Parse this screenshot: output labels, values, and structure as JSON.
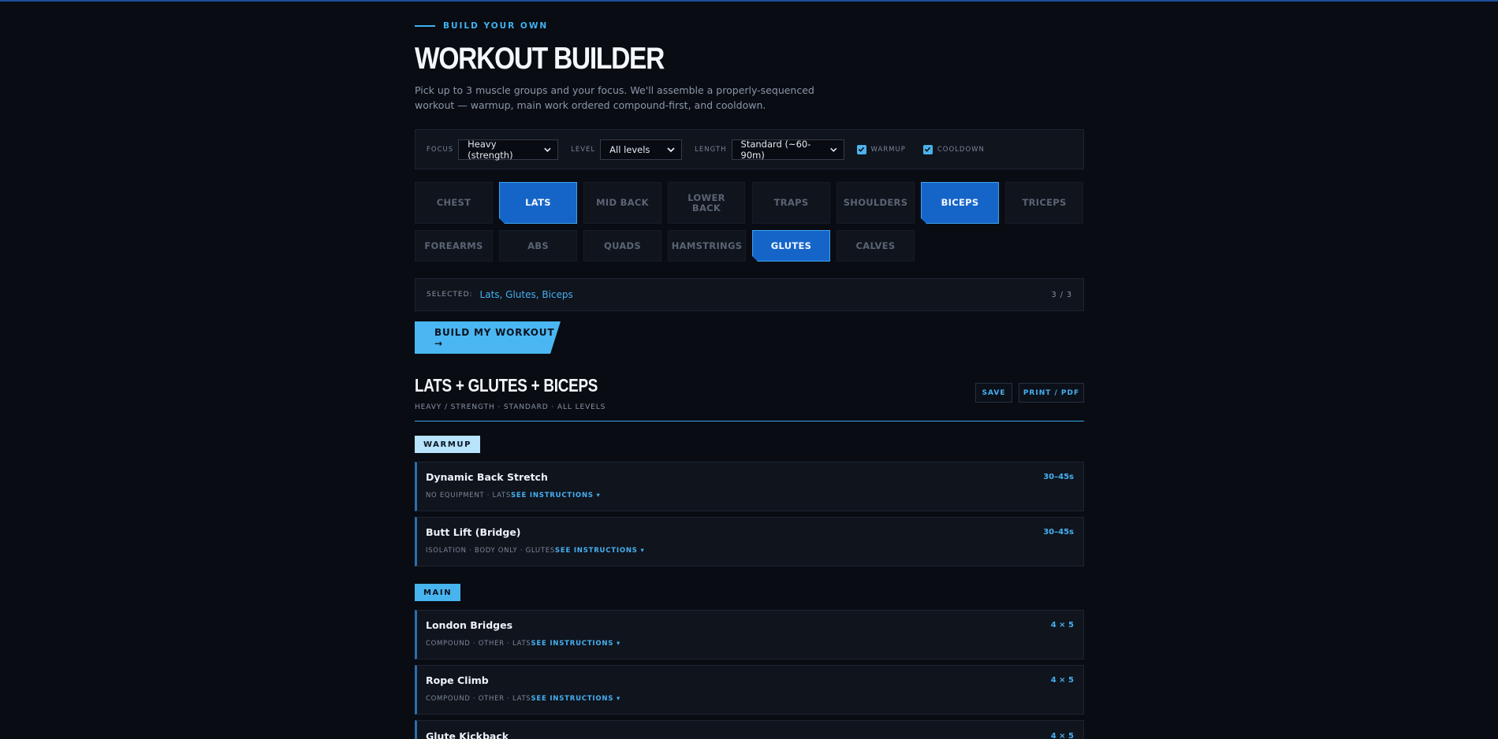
{
  "header": {
    "eyebrow": "BUILD YOUR OWN",
    "title": "WORKOUT BUILDER",
    "subtitle": "Pick up to 3 muscle groups and your focus. We'll assemble a properly-sequenced workout — warmup, main work ordered compound-first, and cooldown."
  },
  "controls": {
    "focus_label": "FOCUS",
    "focus_value": "Heavy (strength)",
    "level_label": "LEVEL",
    "level_value": "All levels",
    "length_label": "LENGTH",
    "length_value": "Standard (~60-90m)",
    "warmup_label": "WARMUP",
    "warmup_checked": true,
    "cooldown_label": "COOLDOWN",
    "cooldown_checked": true
  },
  "muscles": [
    {
      "label": "CHEST",
      "active": false
    },
    {
      "label": "LATS",
      "active": true
    },
    {
      "label": "MID BACK",
      "active": false
    },
    {
      "label": "LOWER BACK",
      "active": false
    },
    {
      "label": "TRAPS",
      "active": false
    },
    {
      "label": "SHOULDERS",
      "active": false
    },
    {
      "label": "BICEPS",
      "active": true
    },
    {
      "label": "TRICEPS",
      "active": false
    },
    {
      "label": "FOREARMS",
      "active": false
    },
    {
      "label": "ABS",
      "active": false
    },
    {
      "label": "QUADS",
      "active": false
    },
    {
      "label": "HAMSTRINGS",
      "active": false
    },
    {
      "label": "GLUTES",
      "active": true
    },
    {
      "label": "CALVES",
      "active": false
    }
  ],
  "selected": {
    "label": "SELECTED:",
    "value": "Lats, Glutes, Biceps",
    "count": "3 / 3"
  },
  "build_button": "BUILD MY WORKOUT →",
  "result": {
    "title": "LATS + GLUTES + BICEPS",
    "meta": "HEAVY / STRENGTH · STANDARD · ALL LEVELS",
    "save_label": "SAVE",
    "print_label": "PRINT / PDF"
  },
  "sections": {
    "warmup": "WARMUP",
    "main": "MAIN"
  },
  "exercises": [
    {
      "name": "Dynamic Back Stretch",
      "meta": "NO EQUIPMENT · LATS",
      "link": "SEE INSTRUCTIONS ▾",
      "sets": "30–45s"
    },
    {
      "name": "Butt Lift (Bridge)",
      "meta": "ISOLATION · BODY ONLY · GLUTES",
      "link": "SEE INSTRUCTIONS ▾",
      "sets": "30–45s"
    },
    {
      "name": "London Bridges",
      "meta": "COMPOUND · OTHER · LATS",
      "link": "SEE INSTRUCTIONS ▾",
      "sets": "4 × 5"
    },
    {
      "name": "Rope Climb",
      "meta": "COMPOUND · OTHER · LATS",
      "link": "SEE INSTRUCTIONS ▾",
      "sets": "4 × 5"
    },
    {
      "name": "Glute Kickback",
      "meta": "",
      "link": "",
      "sets": "4 × 5"
    }
  ],
  "colors": {
    "background": "#090c13",
    "accent": "#46b0f0",
    "active_chip": "#1565c9"
  }
}
